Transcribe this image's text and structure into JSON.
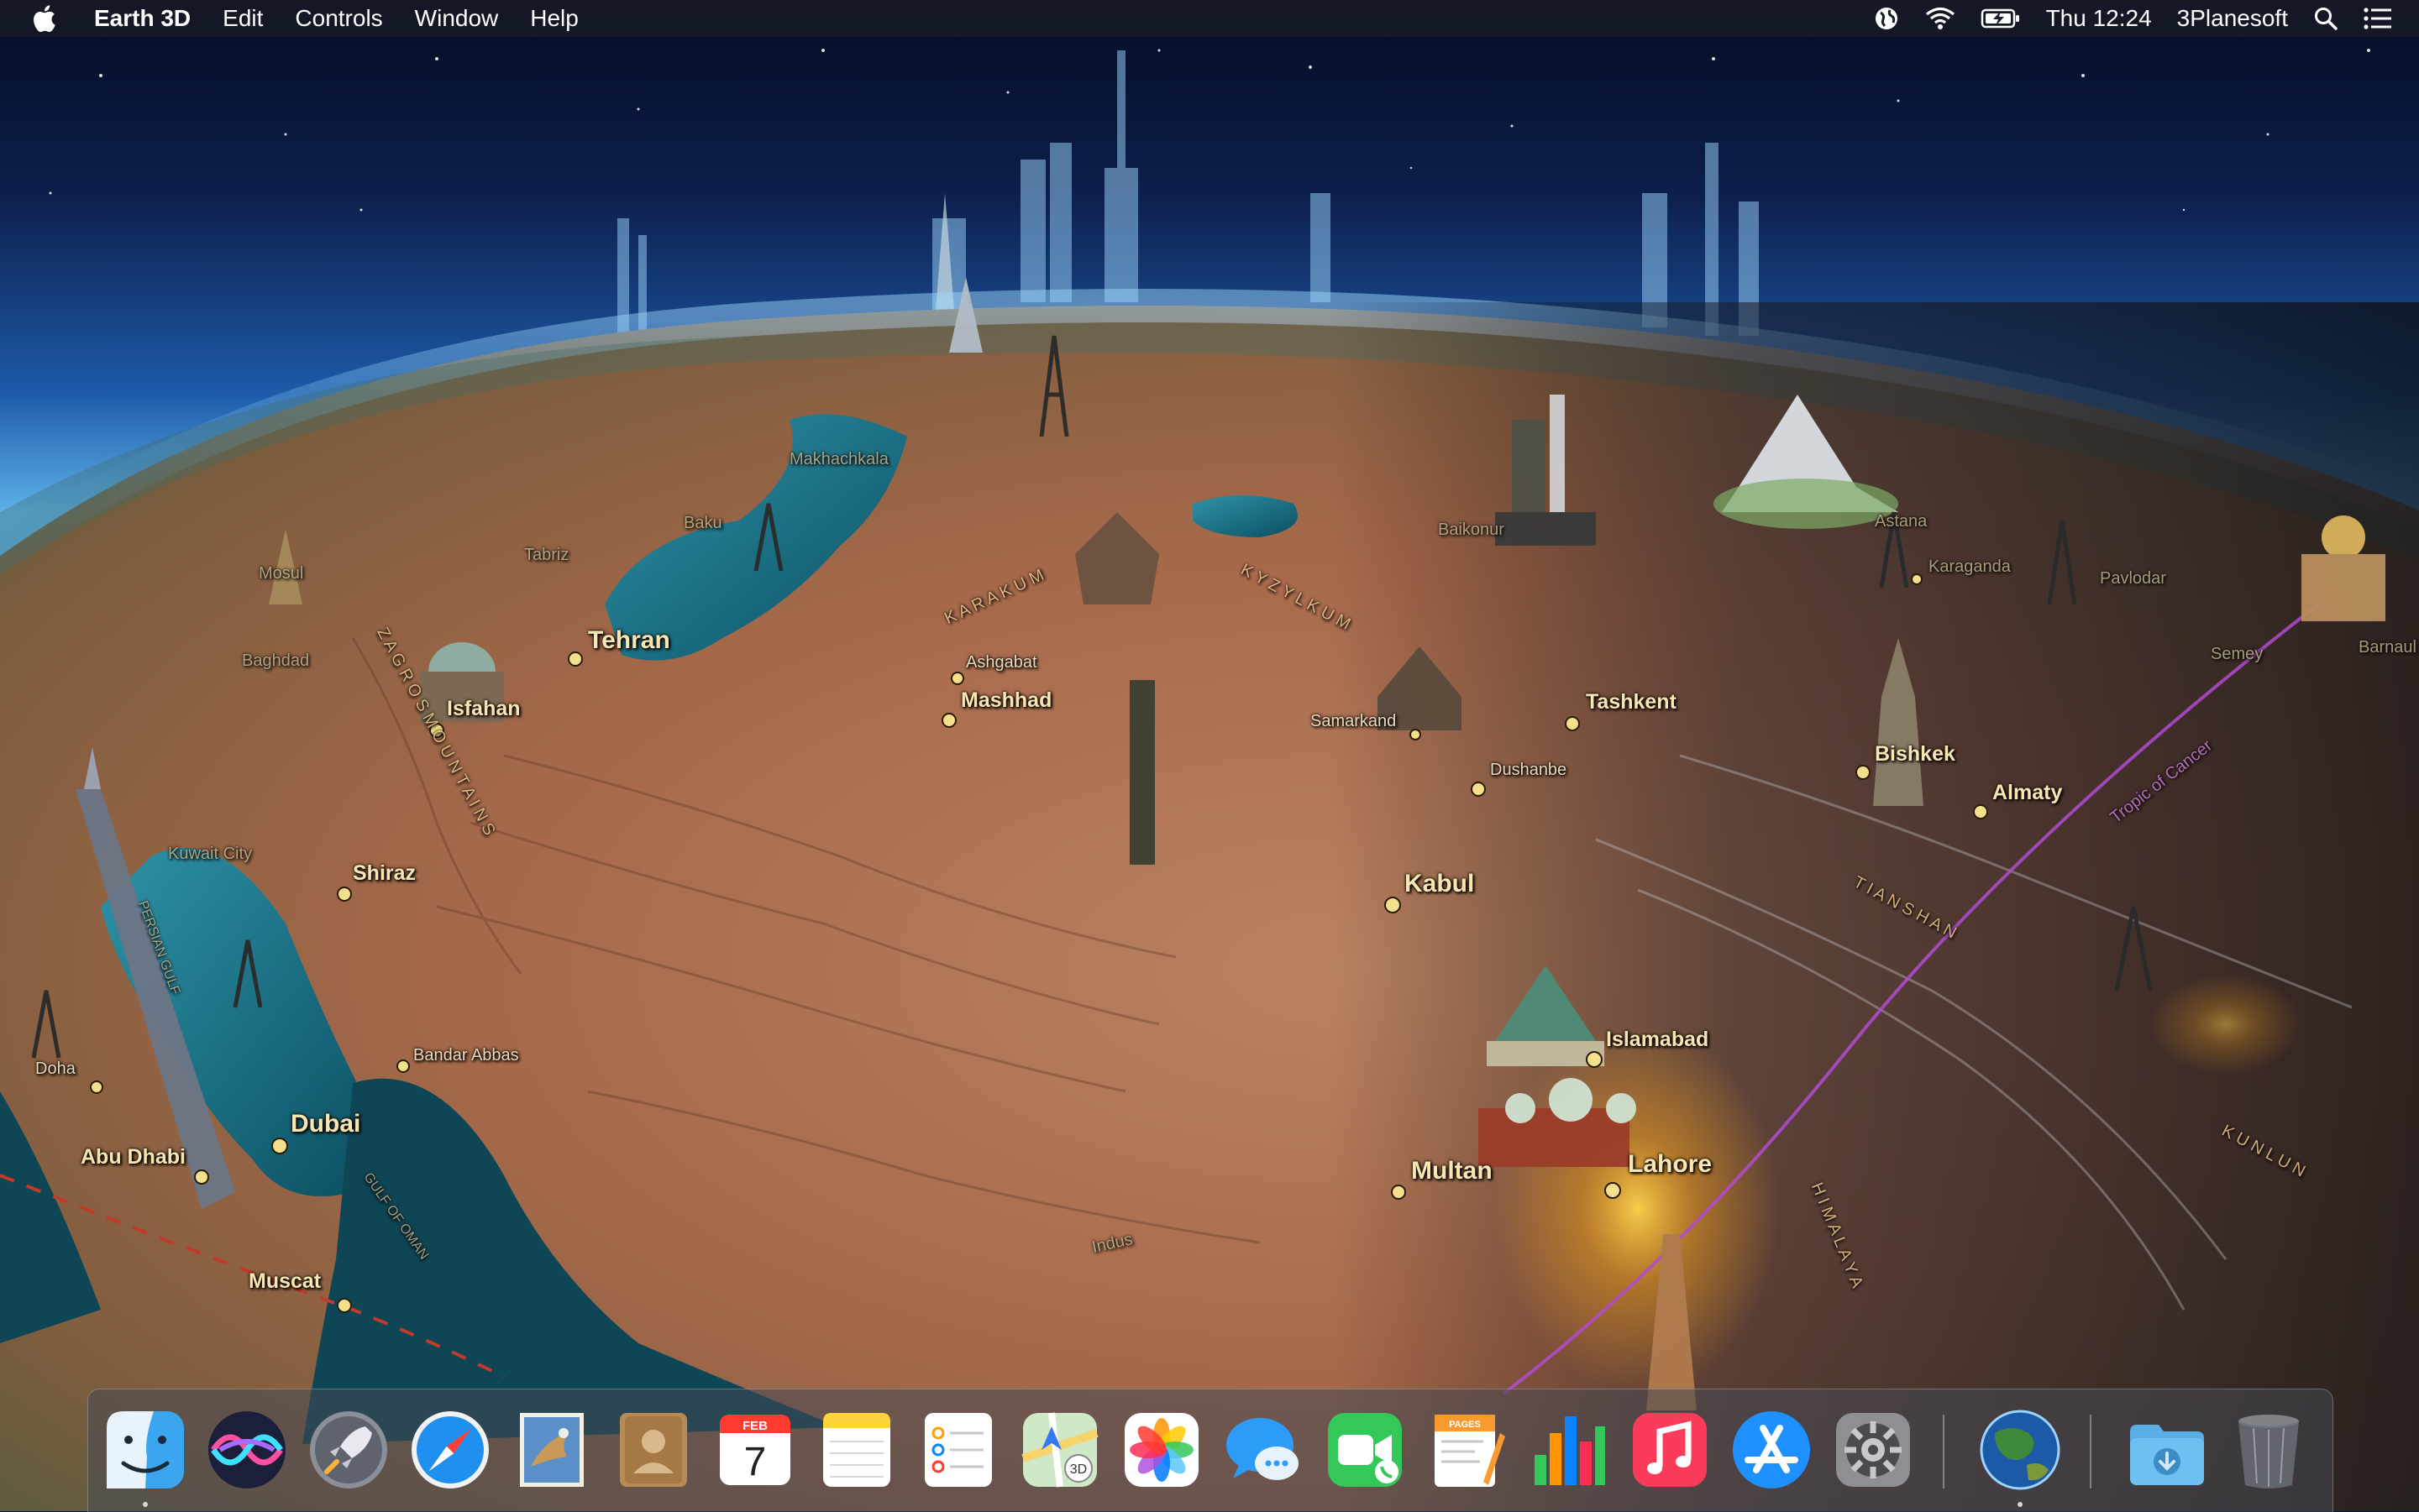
{
  "menubar": {
    "app_name": "Earth 3D",
    "menus": [
      "Edit",
      "Controls",
      "Window",
      "Help"
    ],
    "clock": "Thu 12:24",
    "user": "3Planesoft",
    "status_icons": [
      "globe-icon",
      "wifi-icon",
      "battery-charging-icon",
      "spotlight-search-icon",
      "notification-center-icon"
    ]
  },
  "map": {
    "labels": {
      "tehran": "Tehran",
      "isfahan": "Isfahan",
      "shiraz": "Shiraz",
      "bandar_abbas": "Bandar Abbas",
      "dubai": "Dubai",
      "abu_dhabi": "Abu Dhabi",
      "muscat": "Muscat",
      "doha": "Doha",
      "kuwait_city": "Kuwait City",
      "baghdad": "Baghdad",
      "mosul": "Mosul",
      "tabriz": "Tabriz",
      "ashgabat": "Ashgabat",
      "mashhad": "Mashhad",
      "samarkand": "Samarkand",
      "tashkent": "Tashkent",
      "dushanbe": "Dushanbe",
      "bishkek": "Bishkek",
      "almaty": "Almaty",
      "kabul": "Kabul",
      "islamabad": "Islamabad",
      "lahore": "Lahore",
      "multan": "Multan",
      "karaganda": "Karaganda",
      "pavlodar": "Pavlodar",
      "semey": "Semey",
      "astana": "Astana",
      "baikonur": "Baikonur",
      "makhachkala": "Makhachkala",
      "baku": "Baku",
      "barnaul": "Barnaul",
      "indus": "Indus",
      "persian_gulf": "PERSIAN GULF",
      "gulf_of_oman": "GULF OF OMAN",
      "zagros": "Z A G R O S   M O U N T A I N S",
      "kara_kum": "K A R A   K U M",
      "kyzyl_kum": "K Y Z Y L   K U M",
      "tian_shan": "T I A N   S H A N",
      "himalaya": "H I M A L A Y A",
      "kunlun": "K U N L U N",
      "tropic": "Tropic of Cancer"
    }
  },
  "dock": {
    "apps": [
      {
        "name": "Finder",
        "icon": "finder-icon",
        "running": true
      },
      {
        "name": "Siri",
        "icon": "siri-icon",
        "running": false
      },
      {
        "name": "Launchpad",
        "icon": "launchpad-icon",
        "running": false
      },
      {
        "name": "Safari",
        "icon": "safari-icon",
        "running": false
      },
      {
        "name": "Mail",
        "icon": "mail-icon",
        "running": false
      },
      {
        "name": "Contacts",
        "icon": "contacts-icon",
        "running": false
      },
      {
        "name": "Calendar",
        "icon": "calendar-icon",
        "running": false,
        "month": "FEB",
        "day": "7"
      },
      {
        "name": "Notes",
        "icon": "notes-icon",
        "running": false
      },
      {
        "name": "Reminders",
        "icon": "reminders-icon",
        "running": false
      },
      {
        "name": "Maps",
        "icon": "maps-icon",
        "running": false,
        "badge": "3D"
      },
      {
        "name": "Photos",
        "icon": "photos-icon",
        "running": false
      },
      {
        "name": "Messages",
        "icon": "messages-icon",
        "running": false
      },
      {
        "name": "FaceTime",
        "icon": "facetime-icon",
        "running": false
      },
      {
        "name": "Pages",
        "icon": "pages-icon",
        "running": false,
        "badge": "PAGES"
      },
      {
        "name": "Numbers",
        "icon": "numbers-icon",
        "running": false
      },
      {
        "name": "Music",
        "icon": "music-icon",
        "running": false
      },
      {
        "name": "App Store",
        "icon": "app-store-icon",
        "running": false
      },
      {
        "name": "System Preferences",
        "icon": "system-preferences-icon",
        "running": false
      },
      {
        "name": "Earth 3D",
        "icon": "earth-3d-icon",
        "running": true
      },
      {
        "name": "Downloads",
        "icon": "downloads-folder-icon",
        "running": false
      },
      {
        "name": "Trash",
        "icon": "trash-icon",
        "running": false
      }
    ]
  }
}
